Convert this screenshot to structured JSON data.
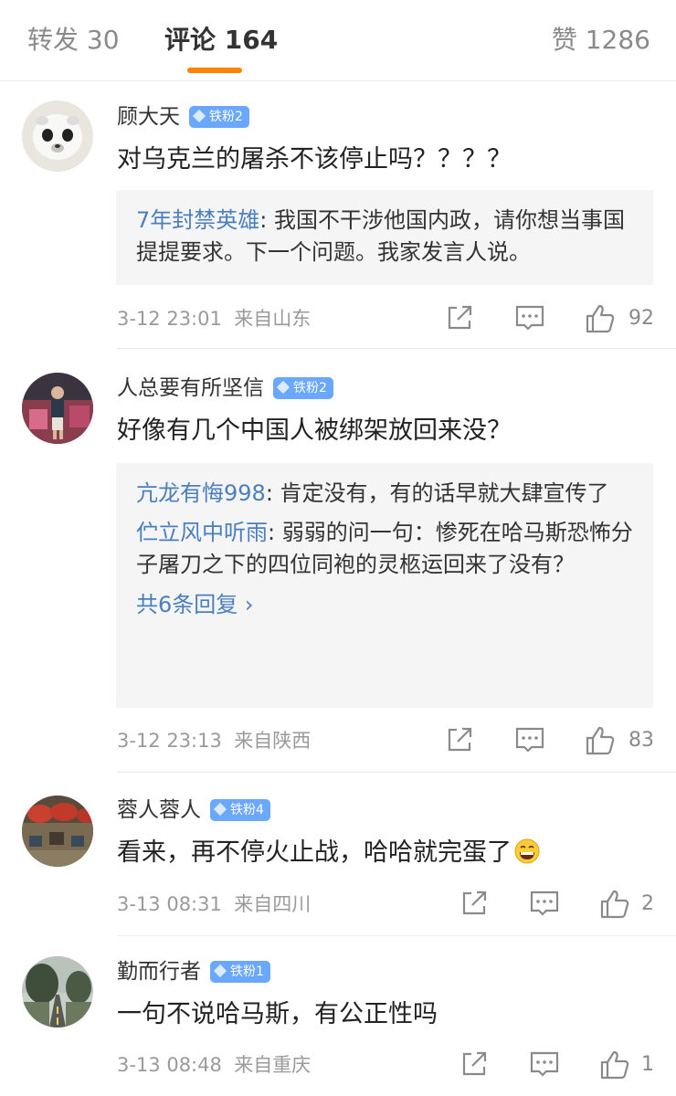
{
  "tabs": {
    "repost": "转发 30",
    "comments": "评论 164",
    "likes": "赞 1286"
  },
  "colors": {
    "accent": "#ff8200",
    "link": "#4a7fbf",
    "badge": "#6aa7ff"
  },
  "comments": [
    {
      "user": "顾大天",
      "badge": "铁粉2",
      "text": "对乌克兰的屠杀不该停止吗？？？？",
      "replies": [
        {
          "user": "7年封禁英雄",
          "text": ": 我国不干涉他国内政，请你想当事国提提要求。下一个问题。我家发言人说。"
        }
      ],
      "time": "3-12 23:01",
      "location": "来自山东",
      "likes": "92"
    },
    {
      "user": "人总要有所坚信",
      "badge": "铁粉2",
      "text": "好像有几个中国人被绑架放回来没？",
      "replies": [
        {
          "user": "亢龙有悔998",
          "text": ": 肯定没有，有的话早就大肆宣传了"
        },
        {
          "user": "伫立风中听雨",
          "text": ": 弱弱的问一句：惨死在哈马斯恐怖分子屠刀之下的四位同袍的灵柩运回来了没有？"
        }
      ],
      "more_replies": "共6条回复 ›",
      "time": "3-12 23:13",
      "location": "来自陕西",
      "likes": "83"
    },
    {
      "user": "蓉人蓉人",
      "badge": "铁粉4",
      "text": "看来，再不停火止战，哈哈就完蛋了",
      "emoji": "grinning-face-emoji",
      "time": "3-13 08:31",
      "location": "来自四川",
      "likes": "2"
    },
    {
      "user": "勤而行者",
      "badge": "铁粉1",
      "text": "一句不说哈马斯，有公正性吗",
      "time": "3-13 08:48",
      "location": "来自重庆",
      "likes": "1"
    }
  ]
}
